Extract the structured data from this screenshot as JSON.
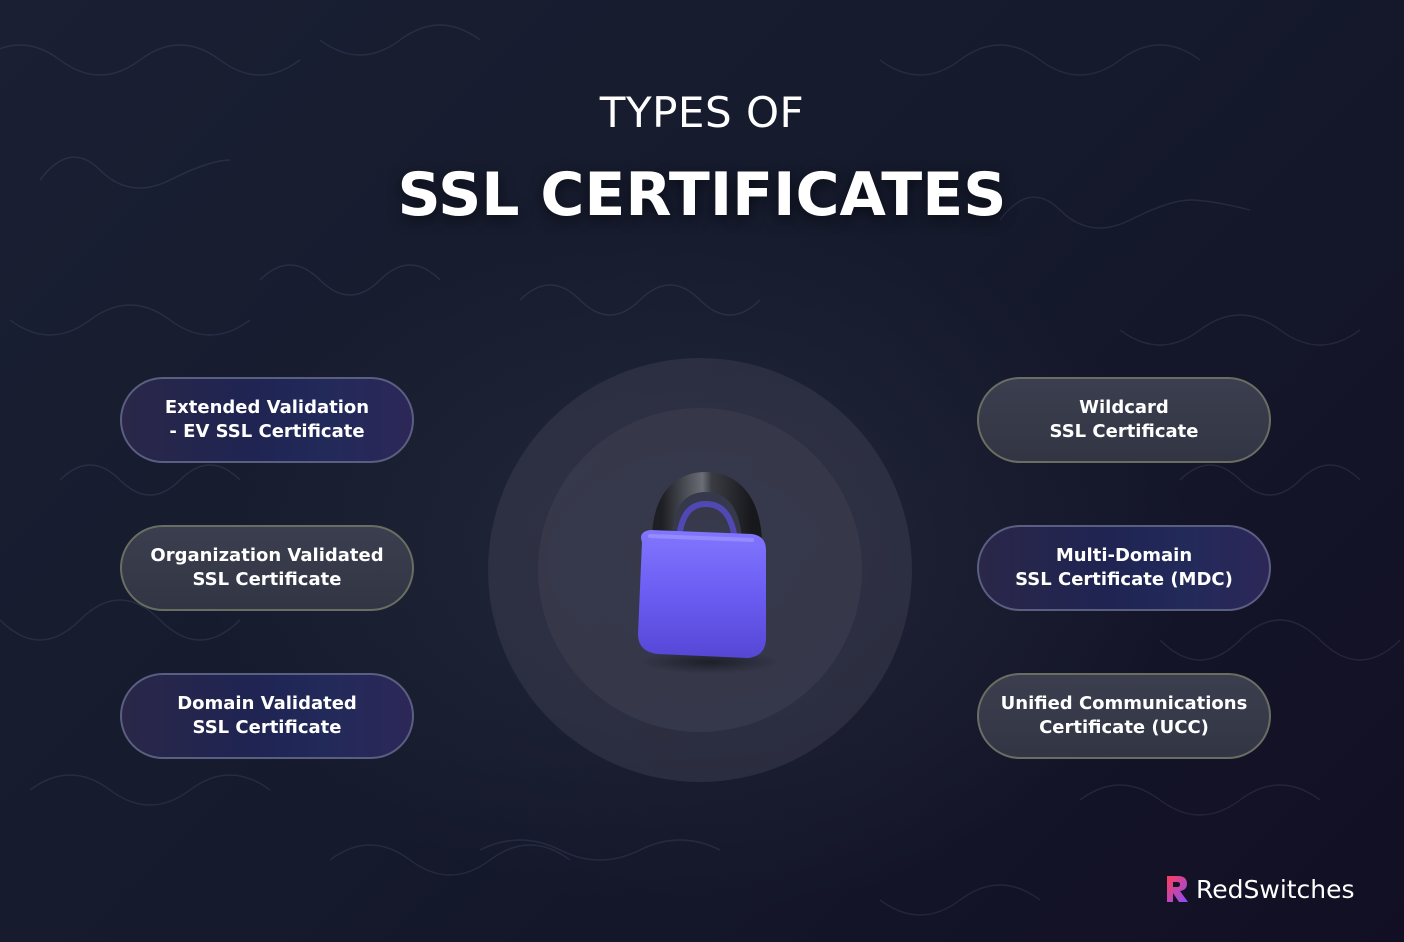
{
  "title": {
    "line1": "TYPES OF",
    "line2": "SSL CERTIFICATES"
  },
  "left_items": [
    {
      "text": "Extended Validation\n- EV SSL Certificate",
      "style": "blue"
    },
    {
      "text": "Organization Validated\nSSL Certificate",
      "style": "gray"
    },
    {
      "text": "Domain Validated\nSSL Certificate",
      "style": "blue"
    }
  ],
  "right_items": [
    {
      "text": "Wildcard\nSSL Certificate",
      "style": "gray"
    },
    {
      "text": "Multi-Domain\nSSL Certificate (MDC)",
      "style": "blue"
    },
    {
      "text": "Unified Communications\nCertificate (UCC)",
      "style": "gray"
    }
  ],
  "center_icon": "padlock-icon",
  "brand": {
    "name": "RedSwitches",
    "logo_icon": "redswitches-logo-icon"
  },
  "colors": {
    "background": "#161a2b",
    "lock_body": "#6a5cf0",
    "lock_shackle": "#2b2d33",
    "logo_gradient_start": "#ff3d57",
    "logo_gradient_end": "#8a4dff"
  }
}
